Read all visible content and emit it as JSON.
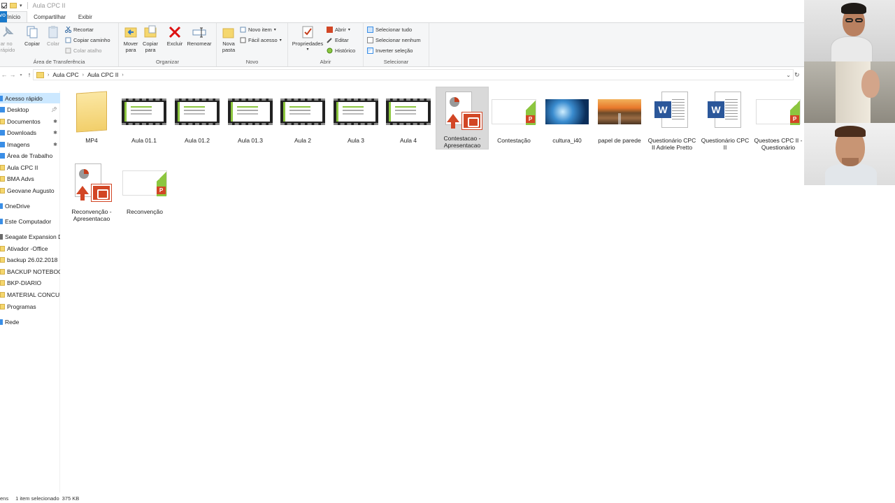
{
  "window": {
    "title": "Aula CPC II"
  },
  "tabs": [
    {
      "label": "vo"
    },
    {
      "label": "Início"
    },
    {
      "label": "Compartilhar"
    },
    {
      "label": "Exibir"
    }
  ],
  "ribbon": {
    "clipboard": {
      "pin_label": "ar no\nrápido",
      "copy": "Copiar",
      "paste": "Colar",
      "cut": "Recortar",
      "copy_path": "Copiar caminho",
      "paste_shortcut": "Colar atalho",
      "group": "Área de Transferência"
    },
    "organize": {
      "move_to": "Mover\npara",
      "copy_to": "Copiar\npara",
      "delete": "Excluir",
      "rename": "Renomear",
      "group": "Organizar"
    },
    "new": {
      "new_folder": "Nova\npasta",
      "new_item": "Novo item",
      "easy_access": "Fácil acesso",
      "group": "Novo"
    },
    "open": {
      "properties": "Propriedades",
      "open": "Abrir",
      "edit": "Editar",
      "history": "Histórico",
      "group": "Abrir"
    },
    "select": {
      "select_all": "Selecionar tudo",
      "select_none": "Selecionar nenhum",
      "invert": "Inverter seleção",
      "group": "Selecionar"
    }
  },
  "breadcrumb": [
    "Aula CPC",
    "Aula CPC II"
  ],
  "sidebar": {
    "items": [
      {
        "label": "Acesso rápido",
        "icon": "star-icon",
        "pinned": false,
        "selected": true
      },
      {
        "label": "Desktop",
        "icon": "folder-icon",
        "pinned": true
      },
      {
        "label": "Documentos",
        "icon": "folder-icon",
        "pinned": true
      },
      {
        "label": "Downloads",
        "icon": "download-icon",
        "pinned": true
      },
      {
        "label": "Imagens",
        "icon": "folder-icon",
        "pinned": true
      },
      {
        "label": "Área de Trabalho",
        "icon": "desktop-icon",
        "pinned": false
      },
      {
        "label": "Aula CPC II",
        "icon": "folder-icon",
        "pinned": false
      },
      {
        "label": "BMA Advs",
        "icon": "folder-icon",
        "pinned": false
      },
      {
        "label": "Geovane Augusto",
        "icon": "folder-icon",
        "pinned": false
      },
      {
        "label": "OneDrive",
        "icon": "cloud-icon",
        "pinned": false
      },
      {
        "label": "Este Computador",
        "icon": "computer-icon",
        "pinned": false
      },
      {
        "label": "Seagate Expansion Dr",
        "icon": "drive-icon",
        "pinned": false
      },
      {
        "label": "Ativador -Office",
        "icon": "folder-icon",
        "pinned": false
      },
      {
        "label": "backup 26.02.2018",
        "icon": "folder-icon",
        "pinned": false
      },
      {
        "label": "BACKUP NOTEBOO",
        "icon": "folder-icon",
        "pinned": false
      },
      {
        "label": "BKP-DIARIO",
        "icon": "folder-icon",
        "pinned": false
      },
      {
        "label": "MATERIAL CONCUI",
        "icon": "folder-icon",
        "pinned": false
      },
      {
        "label": "Programas",
        "icon": "folder-icon",
        "pinned": false
      },
      {
        "label": "Rede",
        "icon": "network-icon",
        "pinned": false
      }
    ]
  },
  "files": [
    {
      "name": "MP4",
      "type": "folder"
    },
    {
      "name": "Aula 01.1",
      "type": "video"
    },
    {
      "name": "Aula 01.2",
      "type": "video"
    },
    {
      "name": "Aula 01.3",
      "type": "video"
    },
    {
      "name": "Aula 2",
      "type": "video"
    },
    {
      "name": "Aula 3",
      "type": "video"
    },
    {
      "name": "Aula 4",
      "type": "video"
    },
    {
      "name": "Contestacao - Apresentacao",
      "type": "pptshow",
      "selected": true
    },
    {
      "name": "Contestação",
      "type": "ppt"
    },
    {
      "name": "cultura_i40",
      "type": "image-blue"
    },
    {
      "name": "papel de parede",
      "type": "image-road"
    },
    {
      "name": "Questionário CPC II Adriele Pretto",
      "type": "word"
    },
    {
      "name": "Questionário CPC II",
      "type": "word"
    },
    {
      "name": "Questoes CPC II - Questionário",
      "type": "ppt"
    },
    {
      "name": "Reconvenção - Apresentacao",
      "type": "pptshow"
    },
    {
      "name": "Reconvenção",
      "type": "ppt"
    }
  ],
  "status": {
    "items": "ens",
    "selected": "1 item selecionado",
    "size": "375 KB"
  },
  "colors": {
    "accent": "#1979ca",
    "selection": "#cce8ff",
    "folder": "#f5d76e",
    "powerpoint": "#d24625",
    "word": "#2b579a"
  }
}
